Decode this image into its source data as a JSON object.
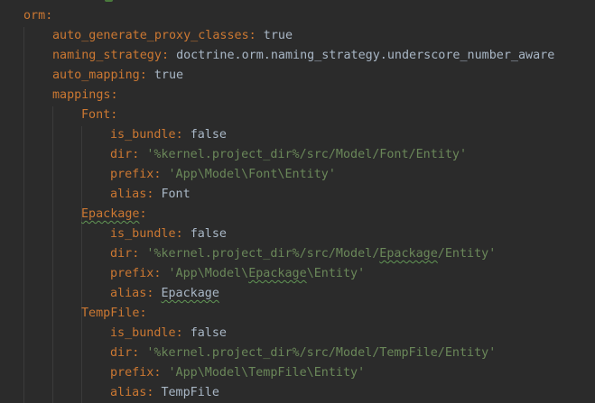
{
  "editor": {
    "colors": {
      "background": "#2b2b2b",
      "key": "#cc7832",
      "value": "#a9b7c6",
      "string": "#6a8759",
      "typo_underline": "#629755"
    },
    "lines": [
      {
        "key": "orm",
        "value": "",
        "value_type": "none"
      },
      {
        "key": "auto_generate_proxy_classes",
        "value": "true",
        "value_type": "scalar"
      },
      {
        "key": "naming_strategy",
        "value": "doctrine.orm.naming_strategy.underscore_number_aware",
        "value_type": "scalar"
      },
      {
        "key": "auto_mapping",
        "value": "true",
        "value_type": "scalar"
      },
      {
        "key": "mappings",
        "value": "",
        "value_type": "none"
      },
      {
        "key": "Font",
        "value": "",
        "value_type": "none"
      },
      {
        "key": "is_bundle",
        "value": "false",
        "value_type": "scalar"
      },
      {
        "key": "dir",
        "value": "'%kernel.project_dir%/src/Model/Font/Entity'",
        "value_type": "string"
      },
      {
        "key": "prefix",
        "value": "'App\\Model\\Font\\Entity'",
        "value_type": "string"
      },
      {
        "key": "alias",
        "value": "Font",
        "value_type": "scalar"
      },
      {
        "key": "Epackage",
        "value": "",
        "value_type": "none"
      },
      {
        "key": "is_bundle",
        "value": "false",
        "value_type": "scalar"
      },
      {
        "key": "dir",
        "value": "'%kernel.project_dir%/src/Model/Epackage/Entity'",
        "value_type": "string"
      },
      {
        "key": "prefix",
        "value": "'App\\Model\\Epackage\\Entity'",
        "value_type": "string"
      },
      {
        "key": "alias",
        "value": "Epackage",
        "value_type": "scalar"
      },
      {
        "key": "TempFile",
        "value": "",
        "value_type": "none"
      },
      {
        "key": "is_bundle",
        "value": "false",
        "value_type": "scalar"
      },
      {
        "key": "dir",
        "value": "'%kernel.project_dir%/src/Model/TempFile/Entity'",
        "value_type": "string"
      },
      {
        "key": "prefix",
        "value": "'App\\Model\\TempFile\\Entity'",
        "value_type": "string"
      },
      {
        "key": "alias",
        "value": "TempFile",
        "value_type": "scalar"
      }
    ]
  }
}
